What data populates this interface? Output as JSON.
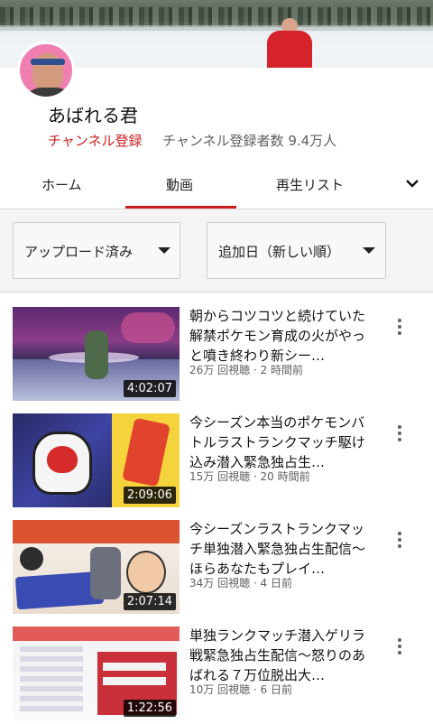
{
  "channel": {
    "name": "あばれる君",
    "subscribe_label": "チャンネル登録",
    "subscriber_count": "チャンネル登録者数 9.4万人"
  },
  "tabs": [
    {
      "label": "ホーム"
    },
    {
      "label": "動画",
      "selected": true
    },
    {
      "label": "再生リスト"
    }
  ],
  "filters": {
    "upload_filter": "アップロード済み",
    "sort_filter": "追加日（新しい順）"
  },
  "videos": [
    {
      "title": "朝からコツコツと続けていた解禁ポケモン育成の火がやっと噴き終わり新シー…",
      "views": "26万 回視聴",
      "age": "2 時間前",
      "duration": "4:02:07"
    },
    {
      "title": "今シーズン本当のポケモンバトルラストランクマッチ駆け込み潜入緊急独占生…",
      "views": "15万 回視聴",
      "age": "20 時間前",
      "duration": "2:09:06"
    },
    {
      "title": "今シーズンラストランクマッチ単独潜入緊急独占生配信〜ほらあなたもプレイ…",
      "views": "34万 回視聴",
      "age": "4 日前",
      "duration": "2:07:14"
    },
    {
      "title": "単独ランクマッチ潜入ゲリラ戦緊急独占生配信〜怒りのあばれる７万位脱出大…",
      "views": "10万 回視聴",
      "age": "6 日前",
      "duration": "1:22:56"
    }
  ],
  "colors": {
    "accent": "#cc1f1f",
    "meta_text": "#606060"
  }
}
